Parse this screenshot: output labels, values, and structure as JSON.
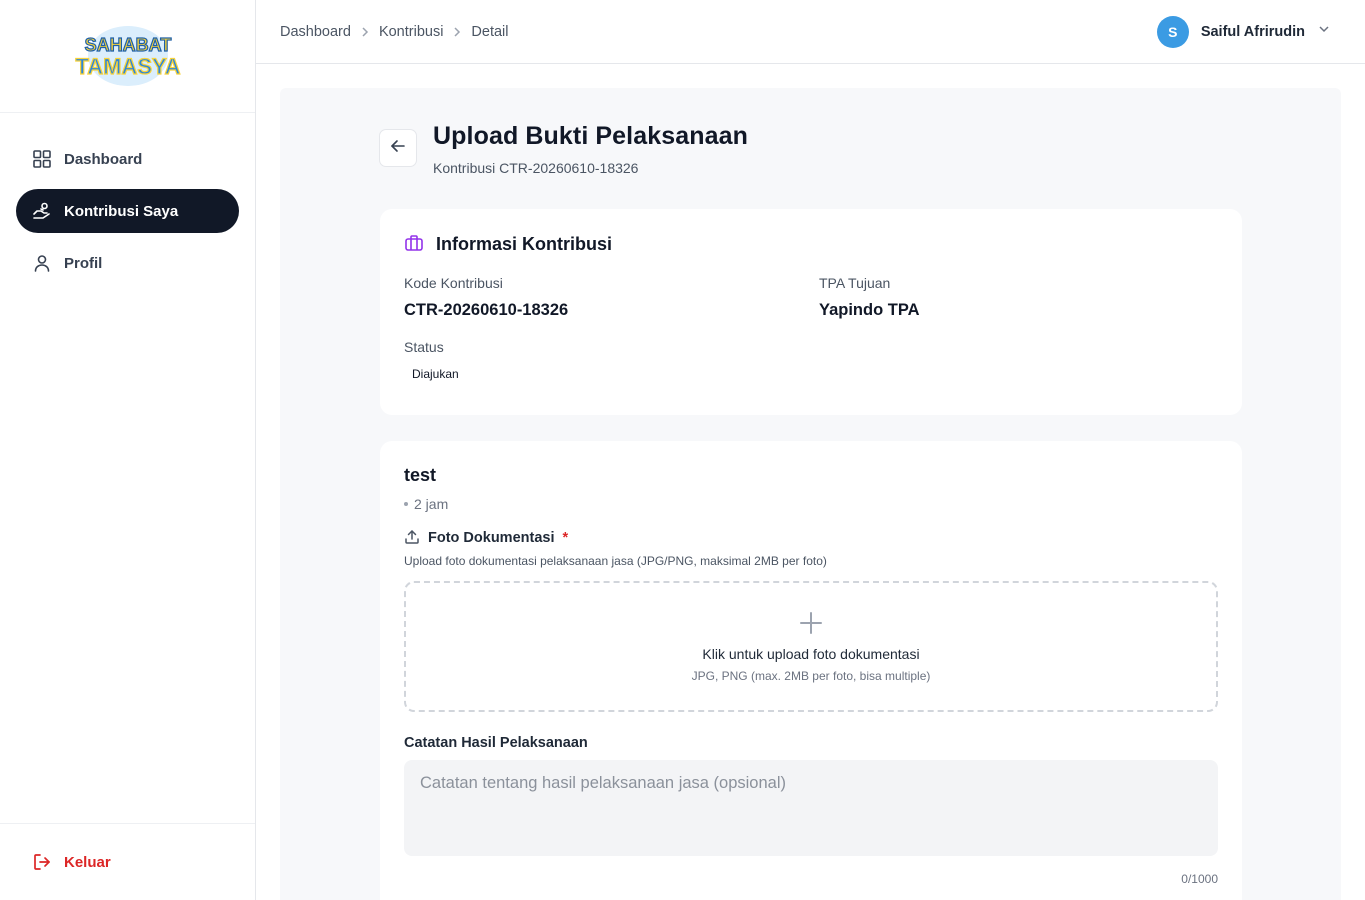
{
  "app": {
    "logo_text_line1": "SAHABAT",
    "logo_text_line2": "TAMASYA",
    "brand_colors": {
      "logo_blue": "#2f86d6",
      "logo_yellow": "#f7d33b",
      "accent_purple": "#9333ea",
      "danger": "#dc2626"
    }
  },
  "sidebar": {
    "items": [
      {
        "label": "Dashboard",
        "icon": "grid-icon",
        "active": false
      },
      {
        "label": "Kontribusi Saya",
        "icon": "hand-coins-icon",
        "active": true
      },
      {
        "label": "Profil",
        "icon": "user-icon",
        "active": false
      }
    ],
    "logout_label": "Keluar"
  },
  "topbar": {
    "breadcrumb": [
      "Dashboard",
      "Kontribusi",
      "Detail"
    ],
    "user": {
      "initial": "S",
      "name": "Saiful Afrirudin"
    }
  },
  "page": {
    "title": "Upload Bukti Pelaksanaan",
    "subtitle": "Kontribusi CTR-20260610-18326"
  },
  "info_card": {
    "title": "Informasi Kontribusi",
    "fields": {
      "kode_label": "Kode Kontribusi",
      "kode_value": "CTR-20260610-18326",
      "tpa_label": "TPA Tujuan",
      "tpa_value": "Yapindo TPA",
      "status_label": "Status",
      "status_value": "Diajukan"
    }
  },
  "upload_card": {
    "title": "test",
    "time": "2 jam",
    "photo_label": "Foto Dokumentasi",
    "required_mark": "*",
    "photo_help": "Upload foto dokumentasi pelaksanaan jasa (JPG/PNG, maksimal 2MB per foto)",
    "dropzone_text": "Klik untuk upload foto dokumentasi",
    "dropzone_hint": "JPG, PNG (max. 2MB per foto, bisa multiple)",
    "notes_label": "Catatan Hasil Pelaksanaan",
    "notes_value": "",
    "notes_placeholder": "Catatan tentang hasil pelaksanaan jasa (opsional)",
    "notes_counter": "0/1000"
  }
}
